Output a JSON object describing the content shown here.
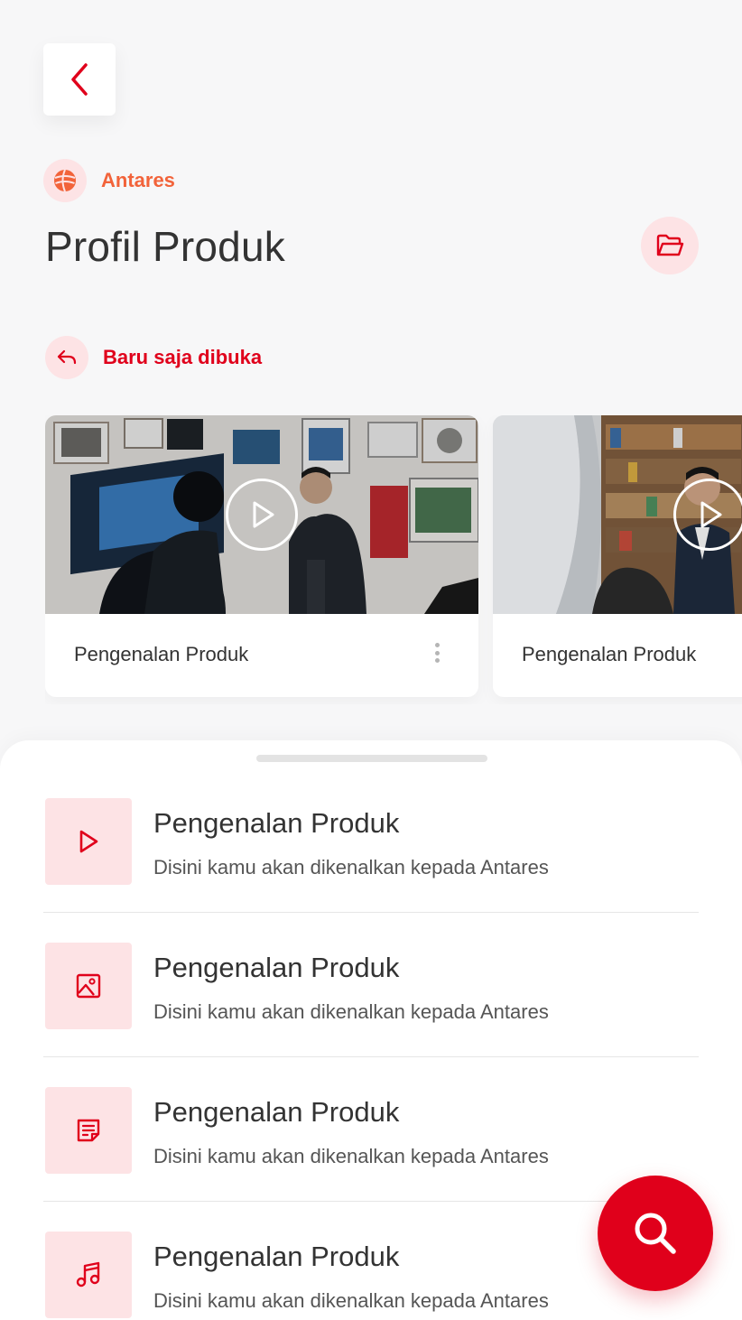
{
  "colors": {
    "primary": "#e0001b",
    "accent_orange": "#f2633a",
    "icon_bg": "#fde3e5",
    "background": "#f7f7f8"
  },
  "header": {
    "back_icon": "chevron-left-icon",
    "brand": {
      "name": "Antares",
      "logo_icon": "globe-logo-icon"
    },
    "title": "Profil Produk",
    "folder_icon": "folder-open-icon"
  },
  "recent": {
    "icon": "reply-icon",
    "label": "Baru saja dibuka",
    "cards": [
      {
        "title": "Pengenalan Produk",
        "play_icon": "play-circle-icon",
        "menu_icon": "more-vertical-icon"
      },
      {
        "title": "Pengenalan Produk",
        "play_icon": "play-circle-icon"
      }
    ]
  },
  "list": {
    "items": [
      {
        "icon": "play-icon",
        "title": "Pengenalan Produk",
        "subtitle": "Disini kamu akan dikenalkan kepada Antares"
      },
      {
        "icon": "image-icon",
        "title": "Pengenalan Produk",
        "subtitle": "Disini kamu akan dikenalkan kepada Antares"
      },
      {
        "icon": "document-icon",
        "title": "Pengenalan Produk",
        "subtitle": "Disini kamu akan dikenalkan kepada Antares"
      },
      {
        "icon": "music-icon",
        "title": "Pengenalan Produk",
        "subtitle": "Disini kamu akan dikenalkan kepada Antares"
      }
    ]
  },
  "fab": {
    "icon": "search-icon"
  }
}
